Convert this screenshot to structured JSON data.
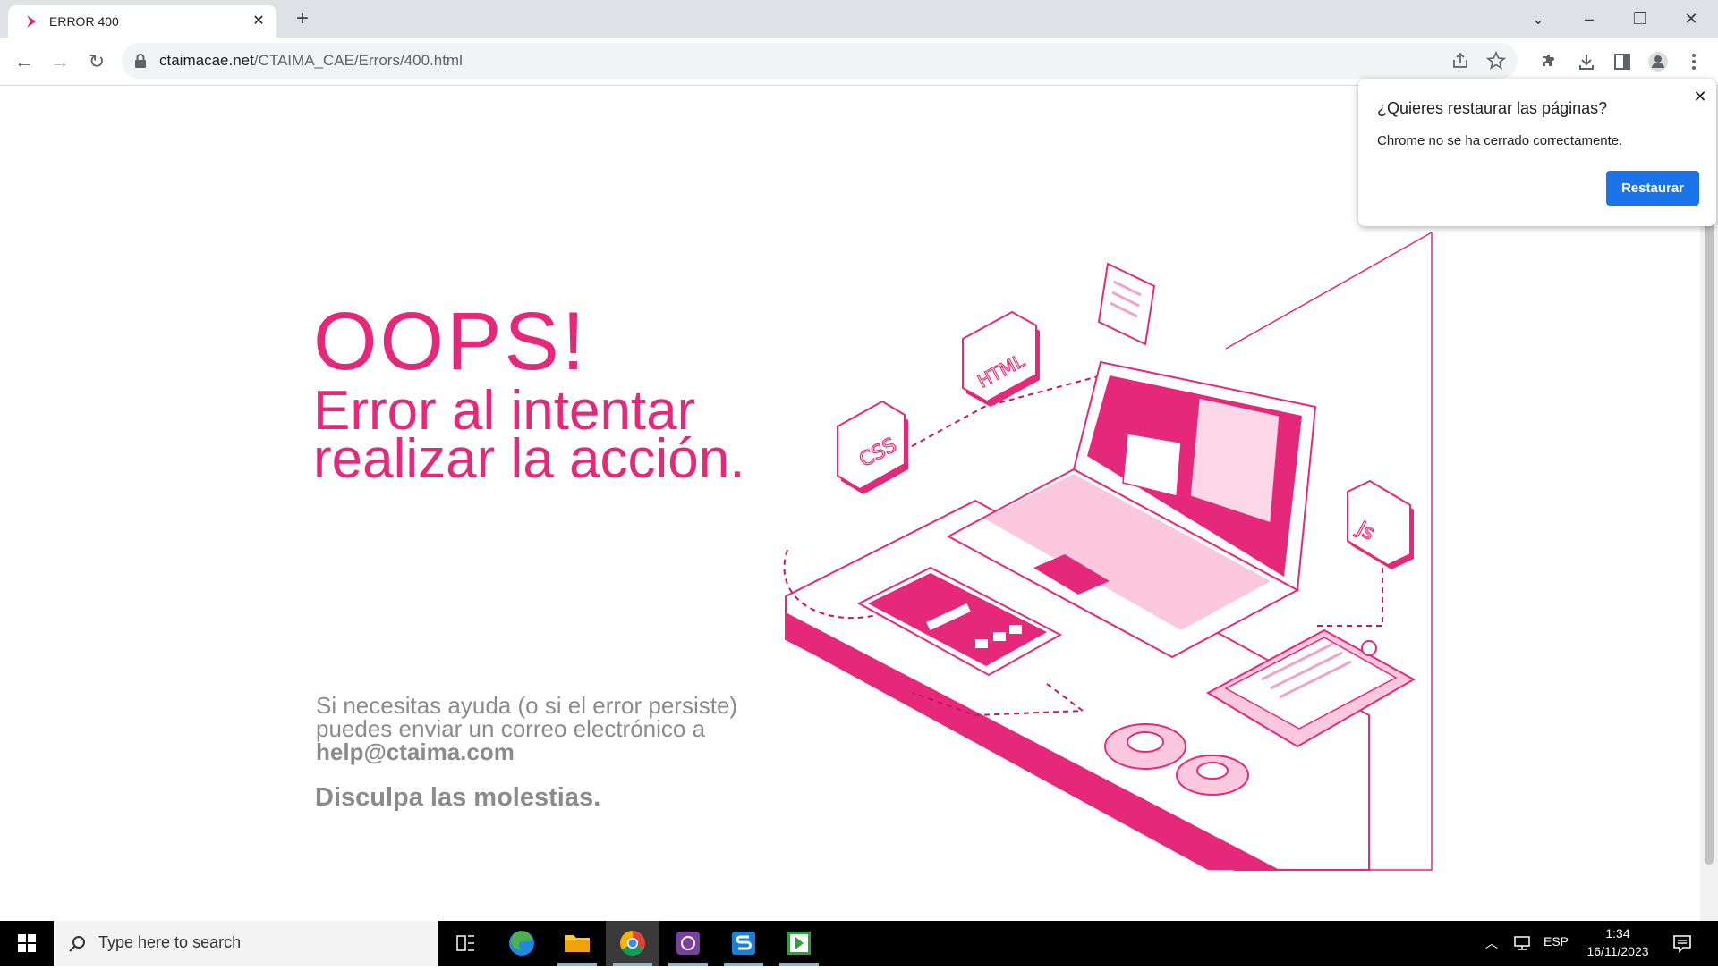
{
  "browser": {
    "tab_title": "ERROR 400",
    "url_host": "ctaimacae.net",
    "url_path": "/CTAIMA_CAE/Errors/400.html"
  },
  "page": {
    "headline": "OOPS!",
    "error_line1": "Error al intentar",
    "error_line2": "realizar la acción.",
    "help_line1": "Si necesitas ayuda (o si el error persiste)",
    "help_line2": "puedes enviar un correo electrónico a",
    "help_email": "help@ctaima.com",
    "apology": "Disculpa las molestias.",
    "illustration_labels": {
      "css": "CSS",
      "html": "HTML",
      "js": "Js"
    },
    "accent_color": "#e6287a"
  },
  "restore_popup": {
    "title": "¿Quieres restaurar las páginas?",
    "body": "Chrome no se ha cerrado correctamente.",
    "button": "Restaurar"
  },
  "taskbar": {
    "search_placeholder": "Type here to search",
    "language": "ESP",
    "time": "1:34",
    "date": "16/11/2023"
  }
}
